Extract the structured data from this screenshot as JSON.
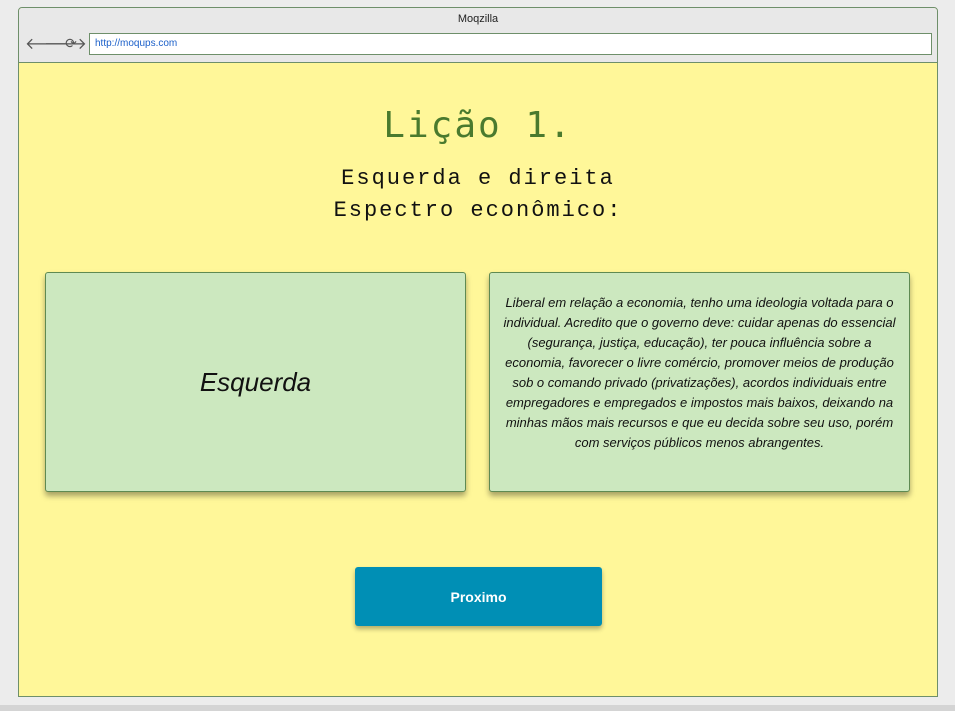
{
  "browser": {
    "title": "Moqzilla",
    "url": "http://moqups.com",
    "icons": [
      "back-arrow-icon",
      "forward-arrow-icon",
      "reload-icon"
    ]
  },
  "page": {
    "heading": "Lição 1.",
    "subtitle_line1": "Esquerda e direita",
    "subtitle_line2": "Espectro econômico:",
    "card_left_label": "Esquerda",
    "card_right_text": "Liberal em relação a economia, tenho uma ideologia voltada para o individual. Acredito que o governo deve: cuidar apenas do essencial (segurança, justiça, educação), ter pouca influência sobre a economia, favorecer o livre comércio, promover meios de produção sob o comando privado (privatizações), acordos individuais entre empregadores e empregados e impostos mais baixos, deixando na minhas mãos mais recursos e que eu decida sobre seu uso, porém com serviços públicos menos abrangentes.",
    "next_button": "Proximo"
  },
  "colors": {
    "background": "#fff799",
    "card": "#cce8bf",
    "heading": "#4a7a2e",
    "button": "#008fb5"
  }
}
